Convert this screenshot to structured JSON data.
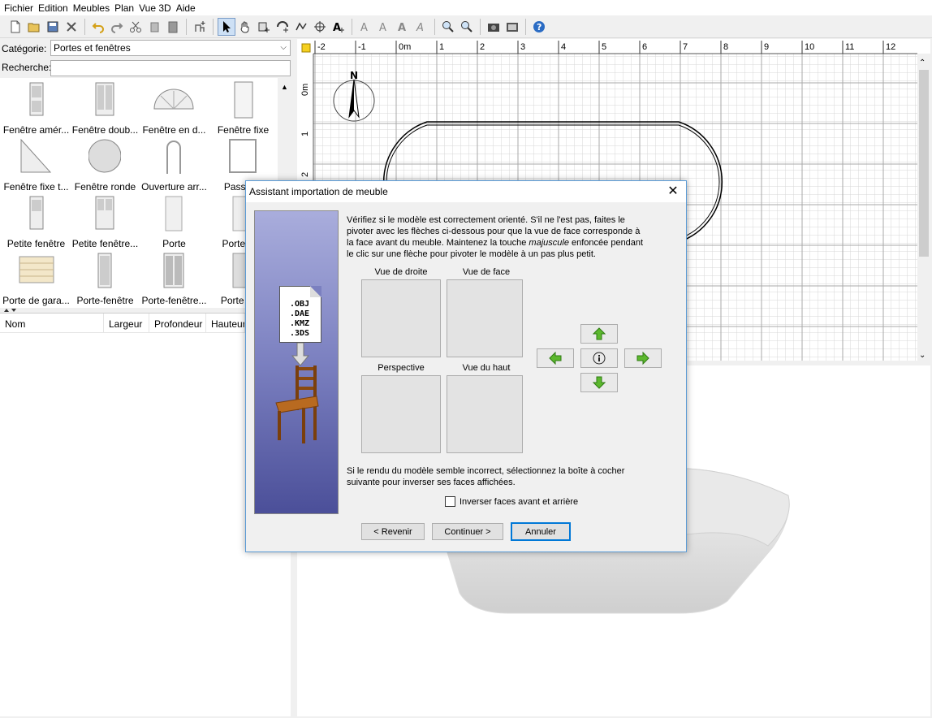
{
  "menu": [
    "Fichier",
    "Edition",
    "Meubles",
    "Plan",
    "Vue 3D",
    "Aide"
  ],
  "toolbar_icons": [
    "new-file-icon",
    "open-icon",
    "save-icon",
    "preferences-icon",
    "undo-icon",
    "redo-icon",
    "cut-icon",
    "copy-icon",
    "paste-icon",
    "add-furniture-icon",
    "select-icon",
    "pan-icon",
    "create-rooms-icon",
    "create-walls-icon",
    "create-polylines-icon",
    "create-dimensions-icon",
    "add-text-icon",
    "modify-text-icon",
    "increase-text-icon",
    "decrease-text-icon",
    "bold-icon",
    "italic-icon",
    "zoom-in-icon",
    "zoom-out-icon",
    "photo-icon",
    "video-icon",
    "help-icon"
  ],
  "catalog": {
    "category_label": "Catégorie:",
    "category_value": "Portes et fenêtres",
    "search_label": "Recherche:",
    "items": [
      {
        "label": "Fenêtre amér...",
        "icon": "window-icon"
      },
      {
        "label": "Fenêtre doub...",
        "icon": "double-window-icon"
      },
      {
        "label": "Fenêtre en d...",
        "icon": "half-round-window-icon"
      },
      {
        "label": "Fenêtre fixe",
        "icon": "fixed-window-icon"
      },
      {
        "label": "Fenêtre fixe t...",
        "icon": "triangle-window-icon"
      },
      {
        "label": "Fenêtre ronde",
        "icon": "round-window-icon"
      },
      {
        "label": "Ouverture arr...",
        "icon": "arched-opening-icon"
      },
      {
        "label": "Passe-...",
        "icon": "pass-through-icon"
      },
      {
        "label": "Petite fenêtre",
        "icon": "small-window-icon"
      },
      {
        "label": "Petite fenêtre...",
        "icon": "small-double-window-icon"
      },
      {
        "label": "Porte",
        "icon": "door-icon"
      },
      {
        "label": "Porte ar...",
        "icon": "door-icon"
      },
      {
        "label": "Porte de gara...",
        "icon": "garage-door-icon"
      },
      {
        "label": "Porte-fenêtre",
        "icon": "french-window-icon"
      },
      {
        "label": "Porte-fenêtre...",
        "icon": "double-french-window-icon"
      },
      {
        "label": "Porte ou...",
        "icon": "door-icon"
      }
    ]
  },
  "furniture_table": {
    "columns": [
      "Nom",
      "Largeur",
      "Profondeur",
      "Hauteur"
    ]
  },
  "plan": {
    "ruler_x": [
      "-2",
      "-1",
      "0m",
      "1",
      "2",
      "3",
      "4",
      "5",
      "6",
      "7",
      "8",
      "9",
      "10",
      "11",
      "12"
    ],
    "ruler_y": [
      "0m",
      "1",
      "2"
    ],
    "compass_label": "N"
  },
  "dialog": {
    "title": "Assistant importation de meuble",
    "formats": [
      ".OBJ",
      ".DAE",
      ".KMZ",
      ".3DS"
    ],
    "instructions_1": "Vérifiez si le modèle est correctement orienté. S'il ne l'est pas, faites le pivoter avec les flèches ci-dessous pour que la vue de face corresponde à la face avant du meuble. Maintenez la touche ",
    "instructions_em": "majuscule",
    "instructions_2": " enfoncée pendant le clic sur une flèche pour pivoter le modèle à un pas plus petit.",
    "views": [
      "Vue de droite",
      "Vue de face",
      "Perspective",
      "Vue du haut"
    ],
    "note": "Si le rendu du modèle semble incorrect, sélectionnez la boîte à cocher suivante pour inverser ses faces affichées.",
    "checkbox_label": "Inverser faces avant et arrière",
    "back_label": "< Revenir",
    "continue_label": "Continuer >",
    "cancel_label": "Annuler",
    "arrow_color": "#5cb82e"
  }
}
